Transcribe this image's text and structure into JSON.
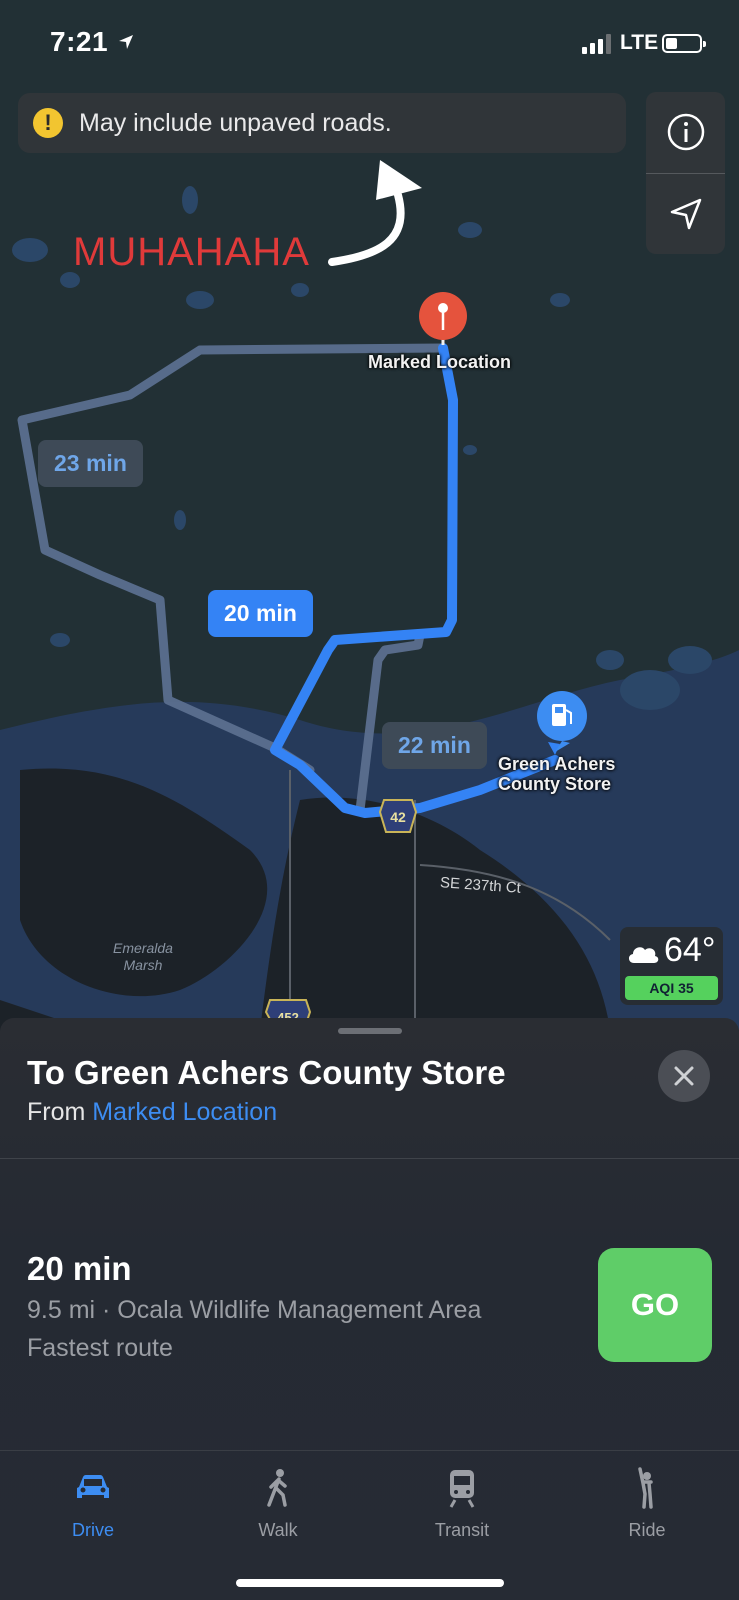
{
  "status": {
    "time": "7:21",
    "network": "LTE"
  },
  "banner": {
    "text": "May include unpaved roads.",
    "icon": "exclamation-icon",
    "icon_glyph": "!",
    "color": "#f2c530"
  },
  "annotation": {
    "text": "MUHAHAHA",
    "color": "#e03a3a"
  },
  "map": {
    "pin_label": "Marked Location",
    "destination_label_line1": "Green Achers",
    "destination_label_line2": "County Store",
    "route_badges": {
      "alt_1": "23 min",
      "main": "20 min",
      "alt_2": "22 min"
    },
    "highway_42": "42",
    "highway_452": "452",
    "street": "SE 237th Ct",
    "area_line1": "Emeralda",
    "area_line2": "Marsh",
    "route_color": "#3483f5",
    "alt_route_color": "#5b6f8f"
  },
  "weather": {
    "temp": "64°",
    "aqi": "AQI 35"
  },
  "sheet": {
    "title": "To Green Achers County Store",
    "from_prefix": "From",
    "from_link": "Marked Location",
    "route_time": "20 min",
    "route_detail": "9.5 mi · Ocala Wildlife Management Area",
    "route_note": "Fastest route",
    "go_label": "GO"
  },
  "tabs": [
    {
      "label": "Drive",
      "icon": "car-icon",
      "active": true
    },
    {
      "label": "Walk",
      "icon": "walk-icon",
      "active": false
    },
    {
      "label": "Transit",
      "icon": "train-icon",
      "active": false
    },
    {
      "label": "Ride",
      "icon": "ride-icon",
      "active": false
    }
  ],
  "colors": {
    "accent": "#3d8df2",
    "go": "#5fcd68",
    "aqi": "#55d15d"
  }
}
